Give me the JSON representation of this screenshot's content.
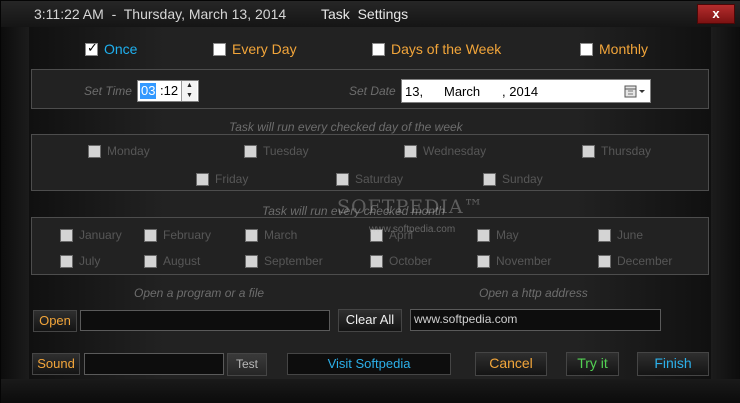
{
  "titlebar": {
    "clock": "3:11:22 AM  -  Thursday, March 13, 2014",
    "title": "Task  Settings",
    "close_label": "x"
  },
  "frequency": {
    "once": "Once",
    "every_day": "Every Day",
    "days_of_week": "Days of the Week",
    "monthly": "Monthly",
    "selected": "Once"
  },
  "schedule": {
    "set_time_label": "Set Time",
    "time_hour": "03",
    "time_minute": ":12",
    "set_date_label": "Set Date",
    "date_day": "13,",
    "date_month": "March",
    "date_year": ", 2014",
    "calendar_icon": "calendar-icon"
  },
  "weekdays": {
    "caption": "Task will run every checked day of the week",
    "days": [
      "Monday",
      "Tuesday",
      "Wednesday",
      "Thursday",
      "Friday",
      "Saturday",
      "Sunday"
    ]
  },
  "months": {
    "caption": "Task will run every checked month",
    "names": [
      "January",
      "February",
      "March",
      "April",
      "May",
      "June",
      "July",
      "August",
      "September",
      "October",
      "November",
      "December"
    ]
  },
  "actions": {
    "program_caption": "Open a program or a file",
    "http_caption": "Open a http address",
    "open_label": "Open",
    "program_value": "",
    "clear_all_label": "Clear All",
    "url_value": "www.softpedia.com",
    "sound_label": "Sound",
    "sound_value": "",
    "test_label": "Test",
    "visit_label": "Visit Softpedia",
    "cancel_label": "Cancel",
    "try_label": "Try it",
    "finish_label": "Finish"
  },
  "watermark": {
    "text": "SOFTPEDIA™",
    "url": "www.softpedia.com"
  },
  "colors": {
    "accent_blue": "#1fb0ef",
    "accent_orange": "#f2a53a",
    "accent_green": "#53d153",
    "close_red": "#a02020"
  }
}
